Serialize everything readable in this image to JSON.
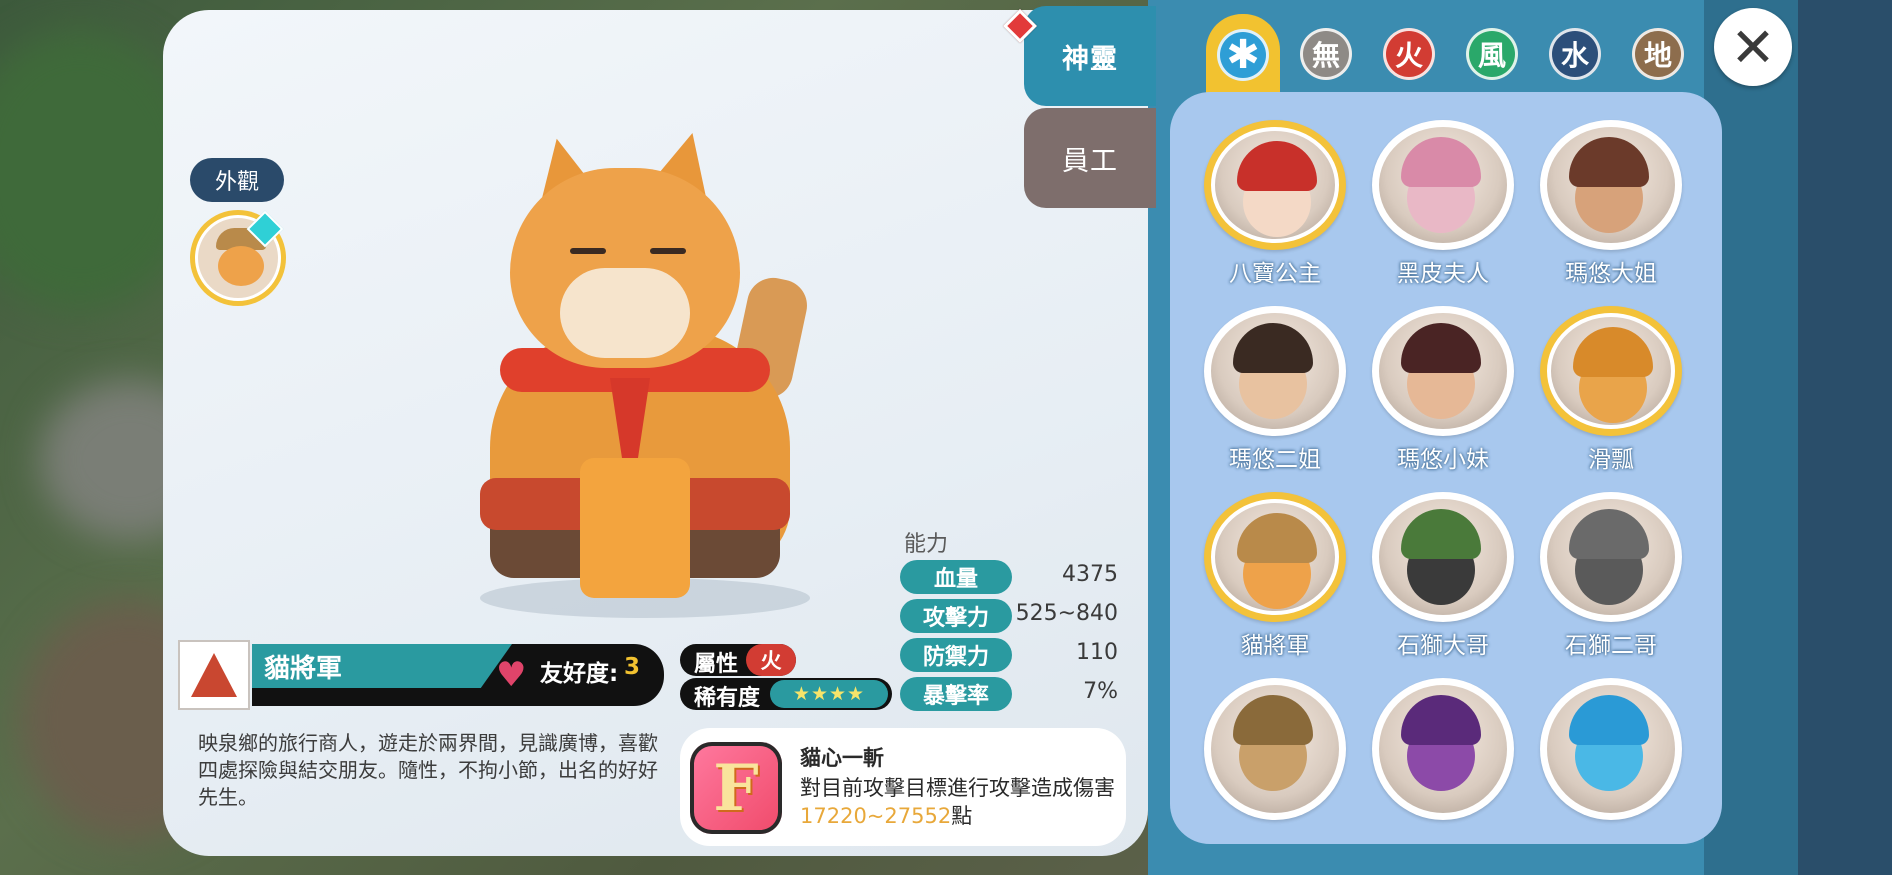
{
  "side_tabs": {
    "spirit": "神靈",
    "staff": "員工"
  },
  "element_tabs": [
    {
      "name": "all",
      "glyph": "✱",
      "color": "#2e9ed6"
    },
    {
      "name": "none",
      "glyph": "無",
      "color": "#8e8a86"
    },
    {
      "name": "fire",
      "glyph": "火",
      "color": "#d23c33"
    },
    {
      "name": "wind",
      "glyph": "風",
      "color": "#2aa86a"
    },
    {
      "name": "water",
      "glyph": "水",
      "color": "#2c4f7a"
    },
    {
      "name": "earth",
      "glyph": "地",
      "color": "#8d6d4d"
    }
  ],
  "close_glyph": "✕",
  "skin": {
    "label": "外觀"
  },
  "character": {
    "name": "貓將軍",
    "affinity_label": "友好度:",
    "affinity_value": "3",
    "description": "映泉鄉的旅行商人，遊走於兩界間，見識廣博，喜歡四處探險與結交朋友。隨性，不拘小節，出名的好好先生。",
    "attribute_label": "屬性",
    "attribute_value": "火",
    "rarity_label": "稀有度",
    "rarity_stars": "★★★★"
  },
  "stats": {
    "title": "能力",
    "rows": [
      {
        "label": "血量",
        "value": "4375"
      },
      {
        "label": "攻擊力",
        "value": "525~840"
      },
      {
        "label": "防禦力",
        "value": "110"
      },
      {
        "label": "暴擊率",
        "value": "7%"
      }
    ]
  },
  "skill": {
    "name": "貓心一斬",
    "desc_prefix": "對目前攻擊目標進行攻擊造成傷害",
    "damage": "17220~27552",
    "desc_suffix": "點"
  },
  "roster": [
    {
      "name": "八寶公主",
      "frame": "gold"
    },
    {
      "name": "黑皮夫人",
      "frame": "white"
    },
    {
      "name": "瑪悠大姐",
      "frame": "white"
    },
    {
      "name": "瑪悠二姐",
      "frame": "white"
    },
    {
      "name": "瑪悠小妹",
      "frame": "white"
    },
    {
      "name": "滑瓢",
      "frame": "gold"
    },
    {
      "name": "貓將軍",
      "frame": "gold"
    },
    {
      "name": "石獅大哥",
      "frame": "white"
    },
    {
      "name": "石獅二哥",
      "frame": "white"
    },
    {
      "name": "",
      "frame": "white"
    },
    {
      "name": "",
      "frame": "white"
    },
    {
      "name": "",
      "frame": "white"
    }
  ]
}
